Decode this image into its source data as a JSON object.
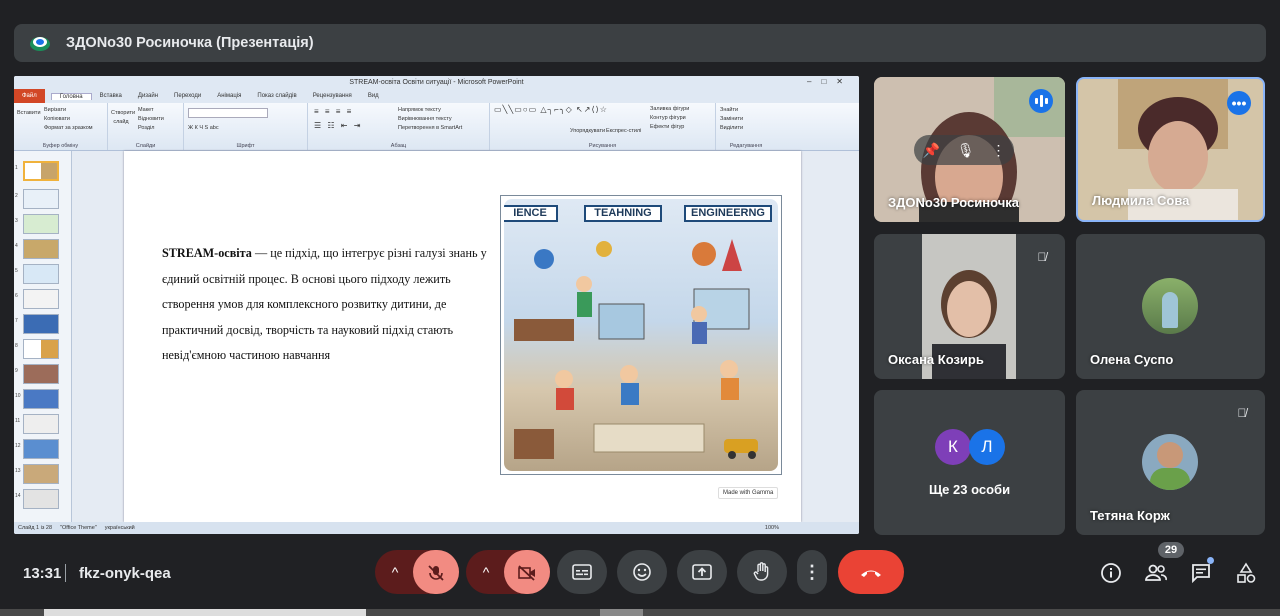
{
  "meeting": {
    "title": "ЗДОNo30 Росиночка (Презентація)",
    "time": "13:31",
    "code": "fkz-onyk-qea",
    "participant_count": "29"
  },
  "powerpoint": {
    "window_title": "STREAM-освіта Освіти ситуації - Microsoft PowerPoint",
    "file_tab": "Файл",
    "tabs": [
      "Головна",
      "Вставка",
      "Дизайн",
      "Переходи",
      "Анімація",
      "Показ слайдів",
      "Рецензування",
      "Вид"
    ],
    "ribbon_groups": [
      {
        "label": "Буфер обміну",
        "items": [
          "Вирізати",
          "Копіювати",
          "Формат за зразком"
        ],
        "big": "Вставити"
      },
      {
        "label": "Слайди",
        "items": [
          "Макет",
          "Відновити",
          "Розділ"
        ],
        "big": "Створити слайд"
      },
      {
        "label": "Шрифт",
        "items": [
          "Ж К Ч S abc",
          "A A"
        ],
        "big": ""
      },
      {
        "label": "Абзац",
        "items": [
          "Напрямок тексту",
          "Вирівнювання тексту",
          "Перетворення в SmartArt"
        ],
        "big": ""
      },
      {
        "label": "Рисування",
        "items": [
          "Упорядкувати",
          "Експрес-стилі",
          "Заливка фігури",
          "Контур фігури",
          "Ефекти фігур"
        ],
        "big": ""
      },
      {
        "label": "Редагування",
        "items": [
          "Знайти",
          "Замінити",
          "Виділити"
        ],
        "big": ""
      }
    ],
    "thumb_numbers": [
      "1",
      "2",
      "3",
      "4",
      "5",
      "6",
      "7",
      "8",
      "9",
      "10",
      "11",
      "12",
      "13",
      "14"
    ],
    "slide_text_bold": "STREAM-освіта",
    "slide_text_rest": " — це підхід, що інтегрує різні галузі знань у єдиний освітній процес. В основі цього підходу лежить створення умов для комплексного розвитку дитини, де практичний досвід, творчість та науковий підхід стають невід'ємною частиною навчання",
    "signs": [
      "IENCE",
      "TEAHNING",
      "ENGINEERNG"
    ],
    "gamma_badge": "Made with Gamma",
    "status": {
      "slide": "Слайд 1 із 28",
      "theme": "\"Office Theme\"",
      "lang": "український",
      "zoom": "100%"
    }
  },
  "participants": [
    {
      "name": "ЗДОNo30 Росиночка",
      "state": "speaking"
    },
    {
      "name": "Людмила Сова",
      "state": "menu"
    },
    {
      "name": "Оксана Козирь",
      "state": "muted"
    },
    {
      "name": "Олена Суспо",
      "state": "normal"
    },
    {
      "name": "Ще 23 особи",
      "avatars": [
        "К",
        "Л"
      ]
    },
    {
      "name": "Тетяна Корж",
      "state": "muted"
    }
  ],
  "colors": {
    "background": "#202124",
    "tile": "#3c4043",
    "hangup": "#ea4335",
    "muted_button": "#f28b82",
    "accent": "#1a73e8"
  }
}
